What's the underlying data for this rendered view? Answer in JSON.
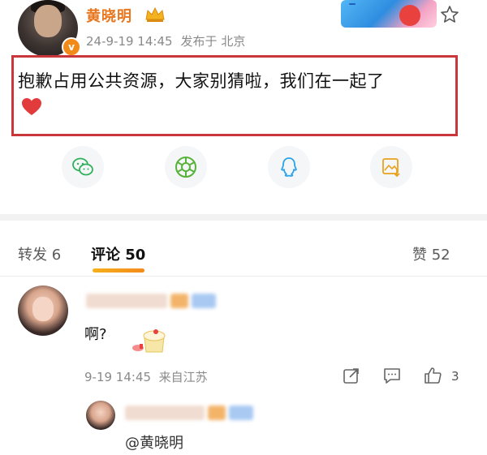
{
  "post": {
    "username": "黄晓明",
    "date": "24-9-19 14:45",
    "location": "发布于 北京",
    "text": "抱歉占用公共资源，大家别猜啦，我们在一起了"
  },
  "icons": {
    "share": [
      "wechat-icon",
      "moments-icon",
      "qq-icon",
      "save-image-icon"
    ],
    "header": [
      "verified-icon",
      "crown-icon",
      "favorite-star-icon"
    ],
    "comment_actions": [
      "share-icon",
      "reply-icon",
      "like-icon"
    ]
  },
  "tabs": {
    "repost": "转发 6",
    "comments": "评论 50",
    "likes": "赞 52"
  },
  "comment": {
    "text": "啊?",
    "time": "9-19 14:45",
    "location": "来自江苏",
    "like_count": "3"
  },
  "reply": {
    "mention": "@黄晓明"
  },
  "colors": {
    "accent_orange": "#e8771f",
    "highlight_box": "#c9363c",
    "tab_underline": "#f5b01c"
  }
}
